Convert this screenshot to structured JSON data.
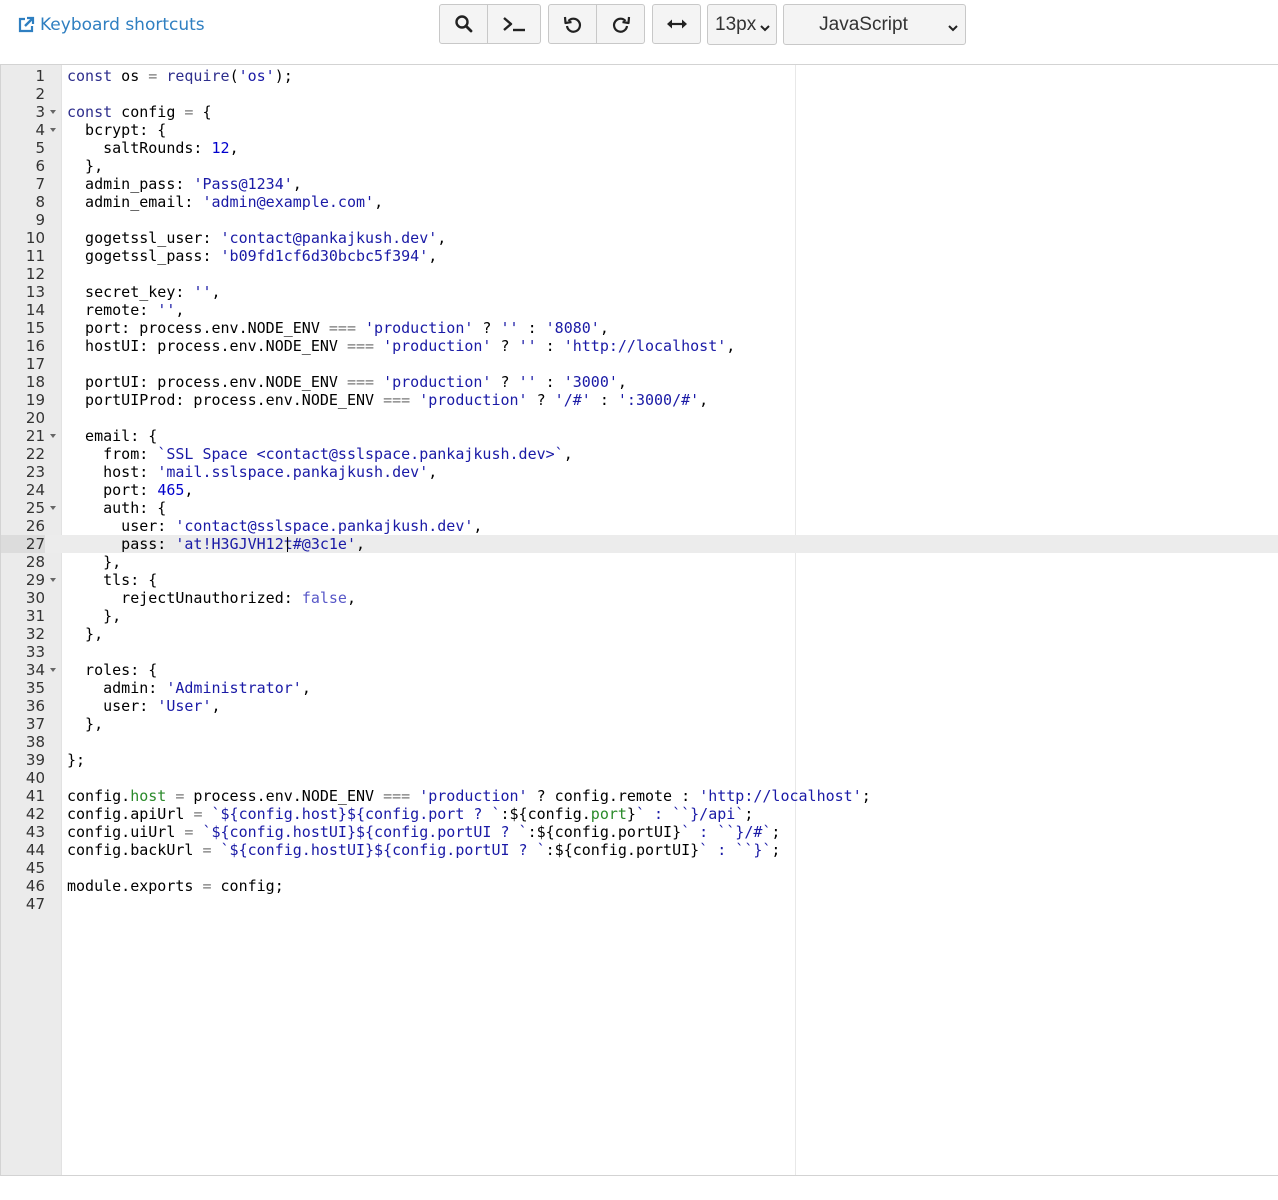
{
  "toolbar": {
    "shortcuts_label": "Keyboard shortcuts",
    "font_size": "13px",
    "language": "JavaScript"
  },
  "editor": {
    "lines": [
      "const os = require('os');",
      "",
      "const config = {",
      "  bcrypt: {",
      "    saltRounds: 12,",
      "  },",
      "  admin_pass: 'Pass@1234',",
      "  admin_email: 'admin@example.com',",
      "",
      "  gogetssl_user: 'contact@pankajkush.dev',",
      "  gogetssl_pass: 'b09fd1cf6d30bcbc5f394',",
      "",
      "  secret_key: '',",
      "  remote: '',",
      "  port: process.env.NODE_ENV === 'production' ? '' : '8080',",
      "  hostUI: process.env.NODE_ENV === 'production' ? '' : 'http://localhost',",
      "",
      "  portUI: process.env.NODE_ENV === 'production' ? '' : '3000',",
      "  portUIProd: process.env.NODE_ENV === 'production' ? '/#' : ':3000/#',",
      "",
      "  email: {",
      "    from: `SSL Space <contact@sslspace.pankajkush.dev>`,",
      "    host: 'mail.sslspace.pankajkush.dev',",
      "    port: 465,",
      "    auth: {",
      "      user: 'contact@sslspace.pankajkush.dev',",
      "      pass: 'at!H3GJVH12t#@3c1e',",
      "    },",
      "    tls: {",
      "      rejectUnauthorized: false,",
      "    },",
      "  },",
      "",
      "  roles: {",
      "    admin: 'Administrator',",
      "    user: 'User',",
      "  },",
      "",
      "};",
      "",
      "config.host = process.env.NODE_ENV === 'production' ? config.remote : 'http://localhost';",
      "config.apiUrl = `${config.host}${config.port ? `:${config.port}` : ``}/api`;",
      "config.uiUrl = `${config.hostUI}${config.portUI ? `:${config.portUI}` : ``}/#`;",
      "config.backUrl = `${config.hostUI}${config.portUI ? `:${config.portUI}` : ``}`;",
      "",
      "module.exports = config;",
      ""
    ],
    "fold_lines": [
      3,
      4,
      21,
      25,
      29,
      34
    ],
    "active_line": 27,
    "cursor_column": 17
  }
}
